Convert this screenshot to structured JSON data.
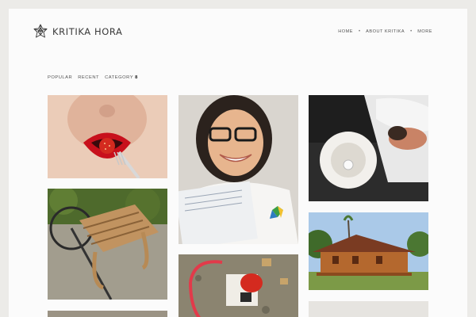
{
  "header": {
    "site_title": "KRITIKA HORA",
    "logo_icon": "geometric-star-logo-icon",
    "nav": [
      {
        "label": "HOME"
      },
      {
        "label": "ABOUT KRITIKA"
      },
      {
        "label": "MORE"
      }
    ]
  },
  "filters": {
    "popular_label": "POPULAR",
    "recent_label": "RECENT",
    "category_label": "CATEGORY",
    "category_count": "8"
  },
  "colors": {
    "background": "#ecebe8",
    "page": "#fbfbfb",
    "text": "#3a3a3a",
    "accent_red": "#d4222a"
  },
  "gallery": [
    {
      "subject": "lips-eating-strawberry-photo"
    },
    {
      "subject": "smiling-girl-glasses-photo"
    },
    {
      "subject": "sleeping-person-lamp-photo"
    },
    {
      "subject": "wooden-sled-bicycle-photo"
    },
    {
      "subject": "red-cassette-toy-photo"
    },
    {
      "subject": "wooden-house-photo"
    }
  ]
}
